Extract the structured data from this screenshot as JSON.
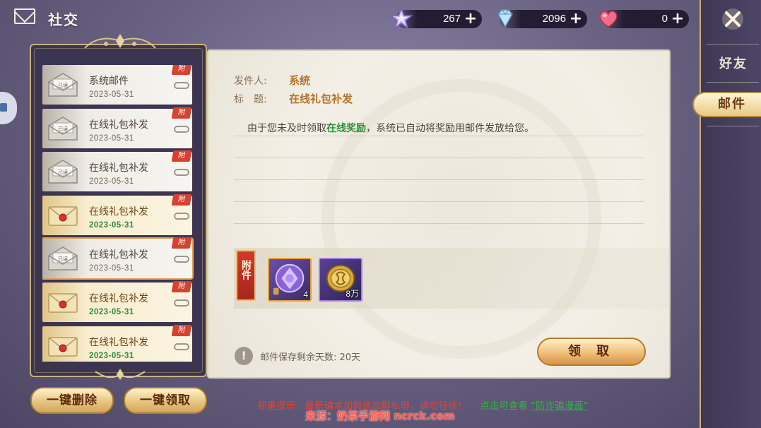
{
  "header": {
    "title": "社交",
    "currencies": [
      {
        "icon": "star-icon",
        "value": "267"
      },
      {
        "icon": "diamond-icon",
        "value": "2096"
      },
      {
        "icon": "heart-icon",
        "value": "0"
      }
    ]
  },
  "tabs": {
    "friends": "好友",
    "mail": "邮件"
  },
  "mail_list": [
    {
      "subject": "系统邮件",
      "date": "2023-05-31",
      "status": "已读",
      "read": true,
      "attach": "附"
    },
    {
      "subject": "在线礼包补发",
      "date": "2023-05-31",
      "status": "已读",
      "read": true,
      "attach": "附"
    },
    {
      "subject": "在线礼包补发",
      "date": "2023-05-31",
      "status": "已读",
      "read": true,
      "attach": "附"
    },
    {
      "subject": "在线礼包补发",
      "date": "2023-05-31",
      "status": "",
      "read": false,
      "attach": "附"
    },
    {
      "subject": "在线礼包补发",
      "date": "2023-05-31",
      "status": "已读",
      "read": true,
      "attach": "附",
      "selected": true
    },
    {
      "subject": "在线礼包补发",
      "date": "2023-05-31",
      "status": "",
      "read": false,
      "attach": "附"
    },
    {
      "subject": "在线礼包补发",
      "date": "2023-05-31",
      "status": "",
      "read": false,
      "attach": "附"
    }
  ],
  "buttons": {
    "delete_all": "一键删除",
    "claim_all": "一键领取",
    "claim": "领 取"
  },
  "detail": {
    "sender_label": "发件人:",
    "sender": "系统",
    "subject_label": "标　题:",
    "subject": "在线礼包补发",
    "body_before": "由于您未及时领取",
    "body_highlight": "在线奖励",
    "body_after": "，系统已自动将奖励用邮件发放给您。",
    "attachments_label": "附件",
    "attachments": [
      {
        "icon": "purple-gem-icon",
        "count": "4"
      },
      {
        "icon": "gold-coin-icon",
        "count": "8万"
      }
    ],
    "retention_text": "邮件保存剩余天数: 20天"
  },
  "footer": {
    "warning": "郑重提示：最新骗术加微信加群私聊，请勿轻信！",
    "view_text": "点击可查看",
    "link_text": "“防诈骗漫画”",
    "source": "来源：奶茶手游网 ncrck.com"
  }
}
